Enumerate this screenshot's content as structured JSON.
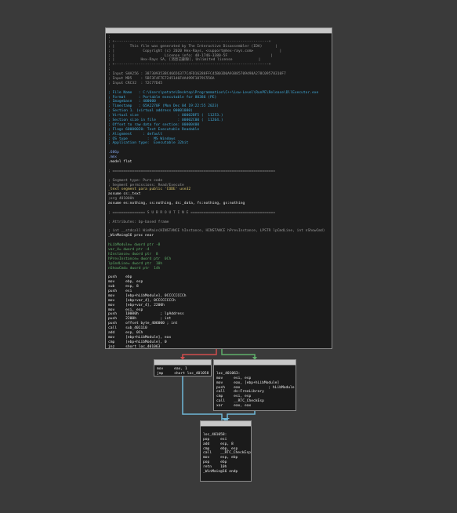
{
  "colors": {
    "edge_true": "#5fae6a",
    "edge_false": "#d04c4c",
    "edge_normal": "#6fb8d8"
  },
  "main_block": [
    {
      "t": ";",
      "c": "c-gray"
    },
    {
      "t": "; +-----------------------------------------------------------------------+",
      "c": "c-gray"
    },
    {
      "t": "; |       This file was generated by The Interactive Disassembler (IDA)      |",
      "c": "c-gray"
    },
    {
      "t": "; |             Copyright (c) 2020 Hex-Rays, <support@hex-rays.com>            |",
      "c": "c-gray"
    },
    {
      "t": "; |                       License info: 48-1746-3380-5F                    |",
      "c": "c-gray"
    },
    {
      "t": "; |            Hex-Rays SA, [消息已删除], Unlimited license            |",
      "c": "c-gray"
    },
    {
      "t": "; +-----------------------------------------------------------------------+",
      "c": "c-gray"
    },
    {
      "t": ";",
      "c": "c-gray"
    },
    {
      "t": "; Input SHA256 : 387309353BC46656377C4FD16288FFC45B03D0A93885709498A278C09578310F7",
      "c": "c-gray"
    },
    {
      "t": "; Input MD5    : 5BF3F4F7E7245146F4A499F1879C556A",
      "c": "c-gray"
    },
    {
      "t": "; Input CRC32  : 72C77D45",
      "c": "c-gray"
    },
    {
      "t": "",
      "c": "c-gray"
    },
    {
      "t": "; File Name   : C:\\Users\\patate\\Desktop\\Programmation\\C++\\Low-Level\\RunPE\\Release\\DllExecutor.exe",
      "c": "c-cyan"
    },
    {
      "t": "; Format      : Portable executable for 80386 (PE)",
      "c": "c-cyan"
    },
    {
      "t": "; Imagebase   : 400000",
      "c": "c-cyan"
    },
    {
      "t": "; Timestamp   : 65A2270F (Mon Dec 04 19:22:55 2023)",
      "c": "c-cyan"
    },
    {
      "t": "; Section 1. (virtual address 00001000)",
      "c": "c-cyan"
    },
    {
      "t": "; Virtual size                  : 00002BF5 (  11253.)",
      "c": "c-cyan"
    },
    {
      "t": "; Section size in file          : 00002C00 (  11264.)",
      "c": "c-cyan"
    },
    {
      "t": "; Offset to raw data for section: 00000400",
      "c": "c-cyan"
    },
    {
      "t": "; Flags 60000020: Text Executable Readable",
      "c": "c-cyan"
    },
    {
      "t": "; Alignment     : default",
      "c": "c-cyan"
    },
    {
      "t": "; OS type         :  MS Windows",
      "c": "c-cyan"
    },
    {
      "t": "; Application type:  Executable 32bit",
      "c": "c-cyan"
    },
    {
      "t": "",
      "c": "c-gray"
    },
    {
      "t": ".686p",
      "c": "c-blue"
    },
    {
      "t": ".mmx",
      "c": "c-blue"
    },
    {
      "t": ".model flat",
      "c": "c-white"
    },
    {
      "t": "",
      "c": "c-gray"
    },
    {
      "t": "; ===========================================================================",
      "c": "c-gray"
    },
    {
      "t": "",
      "c": "c-gray"
    },
    {
      "t": "; Segment type: Pure code",
      "c": "c-gray"
    },
    {
      "t": "; Segment permissions: Read/Execute",
      "c": "c-gray"
    },
    {
      "t": "_text segment para public 'CODE' use32",
      "c": "c-yellow"
    },
    {
      "t": "assume cs:_text",
      "c": "c-white"
    },
    {
      "t": ";org 401000h",
      "c": "c-gray"
    },
    {
      "t": "assume es:nothing, ss:nothing, ds:_data, fs:nothing, gs:nothing",
      "c": "c-white"
    },
    {
      "t": "",
      "c": "c-gray"
    },
    {
      "t": "; =============== S U B R O U T I N E =======================================",
      "c": "c-gray"
    },
    {
      "t": "",
      "c": "c-gray"
    },
    {
      "t": "; Attributes: bp-based frame",
      "c": "c-gray"
    },
    {
      "t": "",
      "c": "c-gray"
    },
    {
      "t": "; int __stdcall WinMain(HINSTANCE hInstance, HINSTANCE hPrevInstance, LPSTR lpCmdLine, int nShowCmd)",
      "c": "c-gray"
    },
    {
      "t": "_WinMain@16 proc near",
      "c": "c-white"
    },
    {
      "t": "",
      "c": "c-gray"
    },
    {
      "t": "hLibModule= dword ptr -8",
      "c": "c-green"
    },
    {
      "t": "var_4= dword ptr -4",
      "c": "c-green"
    },
    {
      "t": "hInstance= dword ptr  8",
      "c": "c-green"
    },
    {
      "t": "hPrevInstance= dword ptr  0Ch",
      "c": "c-green"
    },
    {
      "t": "lpCmdLine= dword ptr  10h",
      "c": "c-green"
    },
    {
      "t": "nShowCmd= dword ptr  14h",
      "c": "c-green"
    },
    {
      "t": "",
      "c": "c-gray"
    },
    {
      "t": "push    ebp",
      "c": "c-white"
    },
    {
      "t": "mov     ebp, esp",
      "c": "c-white"
    },
    {
      "t": "sub     esp, 8",
      "c": "c-white"
    },
    {
      "t": "push    esi",
      "c": "c-white"
    },
    {
      "t": "mov     [ebp+hLibModule], 0CCCCCCCCh",
      "c": "c-white"
    },
    {
      "t": "mov     [ebp+var_4], 0CCCCCCCCh",
      "c": "c-white"
    },
    {
      "t": "mov     [ebp+var_4], 2200h",
      "c": "c-white"
    },
    {
      "t": "mov     esi, esp",
      "c": "c-white"
    },
    {
      "t": "push    10000h          ; lpAddress",
      "c": "c-white"
    },
    {
      "t": "push    2200h           ; int",
      "c": "c-white"
    },
    {
      "t": "push    offset byte_406000 ; int",
      "c": "c-white"
    },
    {
      "t": "call    sub_401110",
      "c": "c-white"
    },
    {
      "t": "add     esp, 0Ch",
      "c": "c-white"
    },
    {
      "t": "mov     [ebp+hLibModule], eax",
      "c": "c-white"
    },
    {
      "t": "cmp     [ebp+hLibModule], 0",
      "c": "c-white"
    },
    {
      "t": "jnz     short loc_401063",
      "c": "c-white"
    }
  ],
  "left_block": [
    {
      "t": "mov     eax, 1",
      "c": "c-white"
    },
    {
      "t": "jmp     short loc_401058",
      "c": "c-white"
    }
  ],
  "right_block": [
    {
      "t": "",
      "c": "c-gray"
    },
    {
      "t": "loc_401063:",
      "c": "c-white"
    },
    {
      "t": "mov     esi, esp",
      "c": "c-white"
    },
    {
      "t": "mov     eax, [ebp+hLibModule]",
      "c": "c-white"
    },
    {
      "t": "push    eax             ; hLibModule",
      "c": "c-white"
    },
    {
      "t": "call    ds:FreeLibrary",
      "c": "c-white"
    },
    {
      "t": "cmp     esi, esp",
      "c": "c-white"
    },
    {
      "t": "call    __RTC_CheckEsp",
      "c": "c-white"
    },
    {
      "t": "xor     eax, eax",
      "c": "c-white"
    }
  ],
  "bottom_block": [
    {
      "t": "",
      "c": "c-gray"
    },
    {
      "t": "loc_401058:",
      "c": "c-white"
    },
    {
      "t": "pop     esi",
      "c": "c-white"
    },
    {
      "t": "add     esp, 8",
      "c": "c-white"
    },
    {
      "t": "cmp     ebp, esp",
      "c": "c-white"
    },
    {
      "t": "call    __RTC_CheckEsp",
      "c": "c-white"
    },
    {
      "t": "mov     esp, ebp",
      "c": "c-white"
    },
    {
      "t": "pop     ebp",
      "c": "c-white"
    },
    {
      "t": "retn    10h",
      "c": "c-white"
    },
    {
      "t": "_WinMain@16 endp",
      "c": "c-white"
    }
  ]
}
